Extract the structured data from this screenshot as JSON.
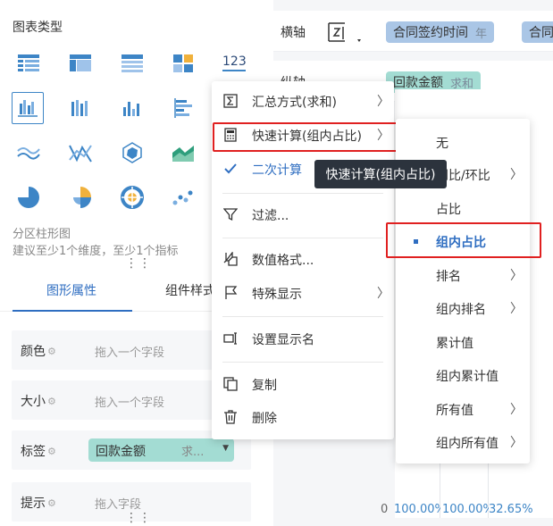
{
  "chart_panel": {
    "title": "图表类型",
    "desc_title": "分区柱形图",
    "desc_hint": "建议至少1个维度，至少1个指标",
    "tabs": [
      "图形属性",
      "组件样式"
    ],
    "props": [
      {
        "label": "颜色",
        "placeholder": "拖入一个字段"
      },
      {
        "label": "大小",
        "placeholder": "拖入一个字段"
      },
      {
        "label": "标签",
        "field": "回款金额",
        "field_sub": "求..."
      },
      {
        "label": "提示",
        "placeholder": "拖入字段"
      }
    ]
  },
  "axes": {
    "x_label": "横轴",
    "x_fields": [
      {
        "name": "合同签约时间",
        "sub": "年"
      },
      {
        "name": "合同"
      }
    ],
    "y_label": "纵轴",
    "y_fields": [
      {
        "name": "回款金额",
        "sub": "求和"
      }
    ]
  },
  "chart_preview": {
    "zero": "0",
    "pct_labels": [
      "100.00%",
      "100.00%",
      "32.65%"
    ]
  },
  "context_menu": {
    "items": [
      {
        "label": "汇总方式(求和)",
        "icon": "sigma-icon",
        "submenu": true
      },
      {
        "label": "快速计算(组内占比)",
        "icon": "calculator-icon",
        "submenu": true
      },
      {
        "label": "二次计算",
        "icon": "check-icon",
        "submenu": false
      },
      {
        "label": "过滤...",
        "icon": "filter-icon",
        "submenu": false
      },
      {
        "label": "数值格式...",
        "icon": "number-format-icon",
        "submenu": false
      },
      {
        "label": "特殊显示",
        "icon": "flag-icon",
        "submenu": true
      },
      {
        "label": "设置显示名",
        "icon": "rename-icon",
        "submenu": false
      },
      {
        "label": "复制",
        "icon": "copy-icon",
        "submenu": false
      },
      {
        "label": "删除",
        "icon": "trash-icon",
        "submenu": false
      }
    ]
  },
  "tooltip": "快速计算(组内占比)",
  "quick_calc_submenu": {
    "items": [
      {
        "label": "无",
        "submenu": false
      },
      {
        "label": "同比/环比",
        "submenu": true
      },
      {
        "label": "占比",
        "submenu": false
      },
      {
        "label": "组内占比",
        "submenu": false,
        "selected": true
      },
      {
        "label": "排名",
        "submenu": true
      },
      {
        "label": "组内排名",
        "submenu": true
      },
      {
        "label": "累计值",
        "submenu": false
      },
      {
        "label": "组内累计值",
        "submenu": false
      },
      {
        "label": "所有值",
        "submenu": true
      },
      {
        "label": "组内所有值",
        "submenu": true
      }
    ]
  },
  "colors": {
    "accent": "#2f6ec1",
    "highlight": "#e02020",
    "teal_pill": "#a3dcd3",
    "blue_pill": "#aac6e6",
    "tooltip_bg": "#2c333d"
  }
}
